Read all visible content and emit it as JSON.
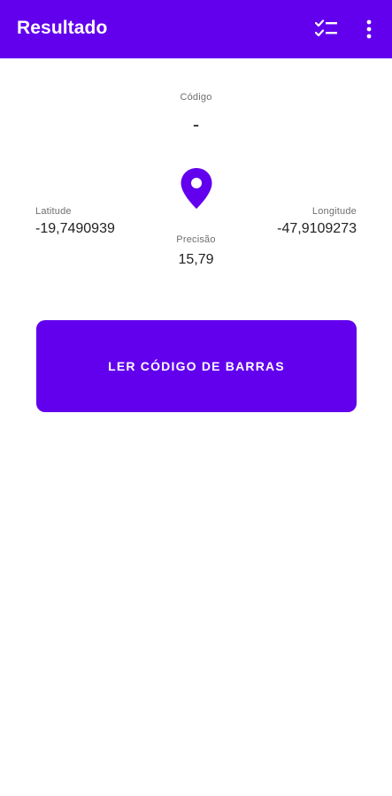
{
  "toolbar": {
    "title": "Resultado",
    "actions": [
      {
        "icon": "checklist-icon"
      },
      {
        "icon": "more-vert-icon"
      }
    ],
    "background": "#6200ee"
  },
  "result": {
    "codigo_label": "Código",
    "codigo_value": "-",
    "latitude_label": "Latitude",
    "latitude_value": "-19,7490939",
    "longitude_label": "Longitude",
    "longitude_value": "-47,9109273",
    "precisao_label": "Precisão",
    "precisao_value": "15,79",
    "location_icon": "location-pin-icon"
  },
  "scan_button": {
    "label": "LER CÓDIGO DE BARRAS"
  },
  "colors": {
    "accent": "#6200ee",
    "text_primary": "#222222",
    "text_secondary": "#6f6f6f",
    "background": "#ffffff"
  }
}
